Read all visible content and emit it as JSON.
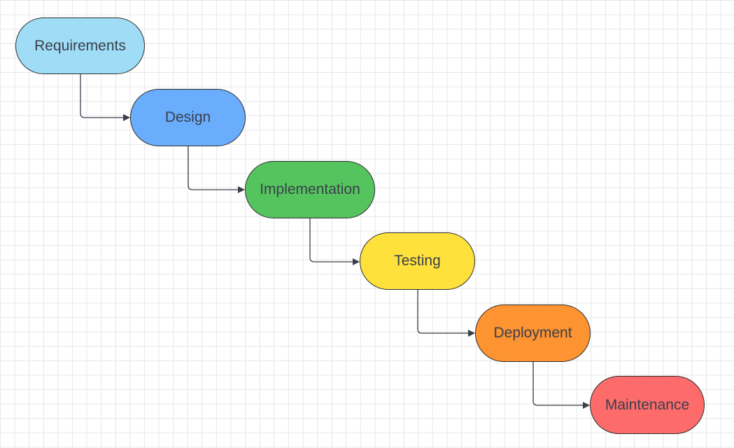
{
  "diagram": {
    "stages": [
      {
        "label": "Requirements",
        "color": "#9fdcf6"
      },
      {
        "label": "Design",
        "color": "#6aadfd"
      },
      {
        "label": "Implementation",
        "color": "#55c45e"
      },
      {
        "label": "Testing",
        "color": "#ffe13c"
      },
      {
        "label": "Deployment",
        "color": "#fd9331"
      },
      {
        "label": "Maintenance",
        "color": "#fe6b6b"
      }
    ],
    "connector_color": "#3a3f4b"
  }
}
